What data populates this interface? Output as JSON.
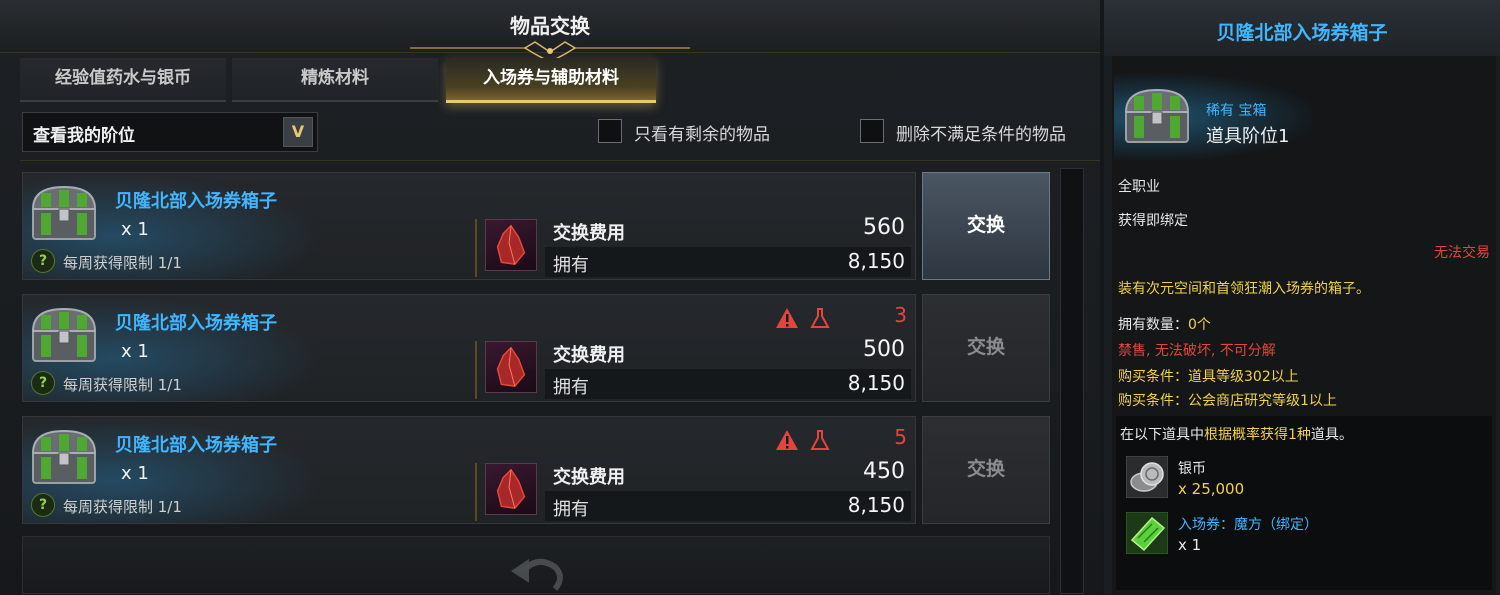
{
  "window": {
    "title": "物品交换"
  },
  "tabs": [
    {
      "label": "经验值药水与银币",
      "active": false
    },
    {
      "label": "精炼材料",
      "active": false
    },
    {
      "label": "入场券与辅助材料",
      "active": true
    }
  ],
  "filters": {
    "rank_select": "查看我的阶位",
    "only_remaining": "只看有剩余的物品",
    "hide_unmet": "删除不满足条件的物品"
  },
  "rows": [
    {
      "name": "贝隆北部入场券箱子",
      "qty": "x 1",
      "limit": "每周获得限制 1/1",
      "cost_label": "交换费用",
      "cost": "560",
      "own_label": "拥有",
      "owned": "8,150",
      "fail_count": "",
      "button": "交换",
      "enabled": true
    },
    {
      "name": "贝隆北部入场券箱子",
      "qty": "x 1",
      "limit": "每周获得限制 1/1",
      "cost_label": "交换费用",
      "cost": "500",
      "own_label": "拥有",
      "owned": "8,150",
      "fail_count": "3",
      "button": "交换",
      "enabled": false
    },
    {
      "name": "贝隆北部入场券箱子",
      "qty": "x 1",
      "limit": "每周获得限制 1/1",
      "cost_label": "交换费用",
      "cost": "450",
      "own_label": "拥有",
      "owned": "8,150",
      "fail_count": "5",
      "button": "交换",
      "enabled": false
    }
  ],
  "tooltip": {
    "title": "贝隆北部入场券箱子",
    "rarity": "稀有 宝箱",
    "tier": "道具阶位1",
    "class": "全职业",
    "bind": "获得即绑定",
    "tradable": "无法交易",
    "description": "装有次元空间和首领狂潮入场券的箱子。",
    "owned_label": "拥有数量：",
    "owned_value": "0个",
    "restrictions": "禁售, 无法破坏, 不可分解",
    "condition1": "购买条件：道具等级302以上",
    "condition2": "购买条件：公会商店研究等级1以上",
    "reward_intro_a": "在以下道具中",
    "reward_intro_b": "根据概率获得1种",
    "reward_intro_c": "道具。",
    "rewards": [
      {
        "name": "银币",
        "qty": "x 25,000"
      },
      {
        "name": "入场券：魔方（绑定）",
        "qty": "x 1"
      }
    ]
  },
  "colors": {
    "accent_gold": "#e8c872",
    "item_blue": "#3fb6ff",
    "warning_red": "#e2453d",
    "condition_yellow": "#f0d24a"
  }
}
